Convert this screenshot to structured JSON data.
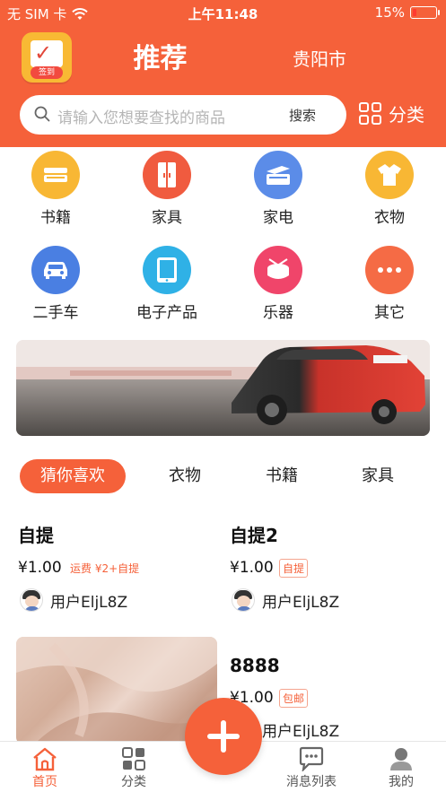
{
  "status_bar": {
    "carrier": "无 SIM 卡",
    "time": "上午11:48",
    "battery": "15%",
    "battery_level": 0.15
  },
  "header": {
    "signin_label": "签到",
    "title": "推荐",
    "city": "贵阳市",
    "search": {
      "placeholder": "请输入您想要查找的商品",
      "button": "搜索"
    },
    "category_button": "分类"
  },
  "categories": [
    {
      "label": "书籍",
      "icon": "book-icon",
      "color": "#f8b734"
    },
    {
      "label": "家具",
      "icon": "wardrobe-icon",
      "color": "#f05b3f"
    },
    {
      "label": "家电",
      "icon": "appliance-icon",
      "color": "#5b8ce8"
    },
    {
      "label": "衣物",
      "icon": "shirt-icon",
      "color": "#f8b734"
    },
    {
      "label": "二手车",
      "icon": "car-icon",
      "color": "#4a7fe2"
    },
    {
      "label": "电子产品",
      "icon": "tablet-icon",
      "color": "#2fb1e6"
    },
    {
      "label": "乐器",
      "icon": "drum-icon",
      "color": "#f0456a"
    },
    {
      "label": "其它",
      "icon": "more-icon",
      "color": "#f56b45"
    }
  ],
  "tabs": [
    {
      "label": "猜你喜欢",
      "active": true
    },
    {
      "label": "衣物",
      "active": false
    },
    {
      "label": "书籍",
      "active": false
    },
    {
      "label": "家具",
      "active": false
    }
  ],
  "products": [
    {
      "title": "自提",
      "price": "¥1.00",
      "tag": "运费 ¥2+自提",
      "user": "用户EljL8Z"
    },
    {
      "title": "自提2",
      "price": "¥1.00",
      "tag": "自提",
      "user": "用户EljL8Z"
    },
    {
      "title": "8888",
      "price": "¥1.00",
      "tag": "包邮",
      "user": "用户EljL8Z"
    }
  ],
  "bottom_nav": [
    {
      "label": "首页",
      "active": true
    },
    {
      "label": "分类",
      "active": false
    },
    {
      "label": "消息列表",
      "active": false
    },
    {
      "label": "我的",
      "active": false
    }
  ],
  "accent_color": "#f5613a"
}
